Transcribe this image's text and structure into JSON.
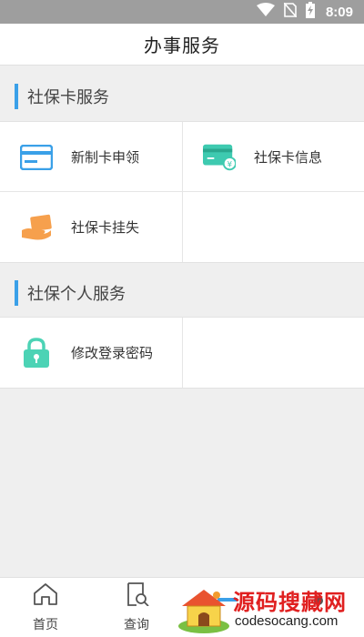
{
  "status_bar": {
    "time": "8:09",
    "icons": [
      "wifi-icon",
      "no-sim-icon",
      "battery-charging-icon"
    ]
  },
  "header": {
    "title": "办事服务"
  },
  "sections": [
    {
      "title": "社保卡服务",
      "items": [
        {
          "label": "新制卡申领",
          "icon": "card-icon"
        },
        {
          "label": "社保卡信息",
          "icon": "card-info-icon"
        },
        {
          "label": "社保卡挂失",
          "icon": "card-loss-icon"
        }
      ]
    },
    {
      "title": "社保个人服务",
      "items": [
        {
          "label": "修改登录密码",
          "icon": "lock-icon"
        }
      ]
    }
  ],
  "tabs": [
    {
      "label": "首页",
      "icon": "home-icon"
    },
    {
      "label": "查询",
      "icon": "search-doc-icon"
    }
  ],
  "watermark": {
    "text": "源码搜藏网",
    "url": "codesocang.com"
  },
  "colors": {
    "accent": "#3aa0e8",
    "card_blue": "#3aa0e8",
    "card_teal": "#3ecab0",
    "card_orange": "#f6a04d",
    "lock_green": "#4cd3b5"
  }
}
